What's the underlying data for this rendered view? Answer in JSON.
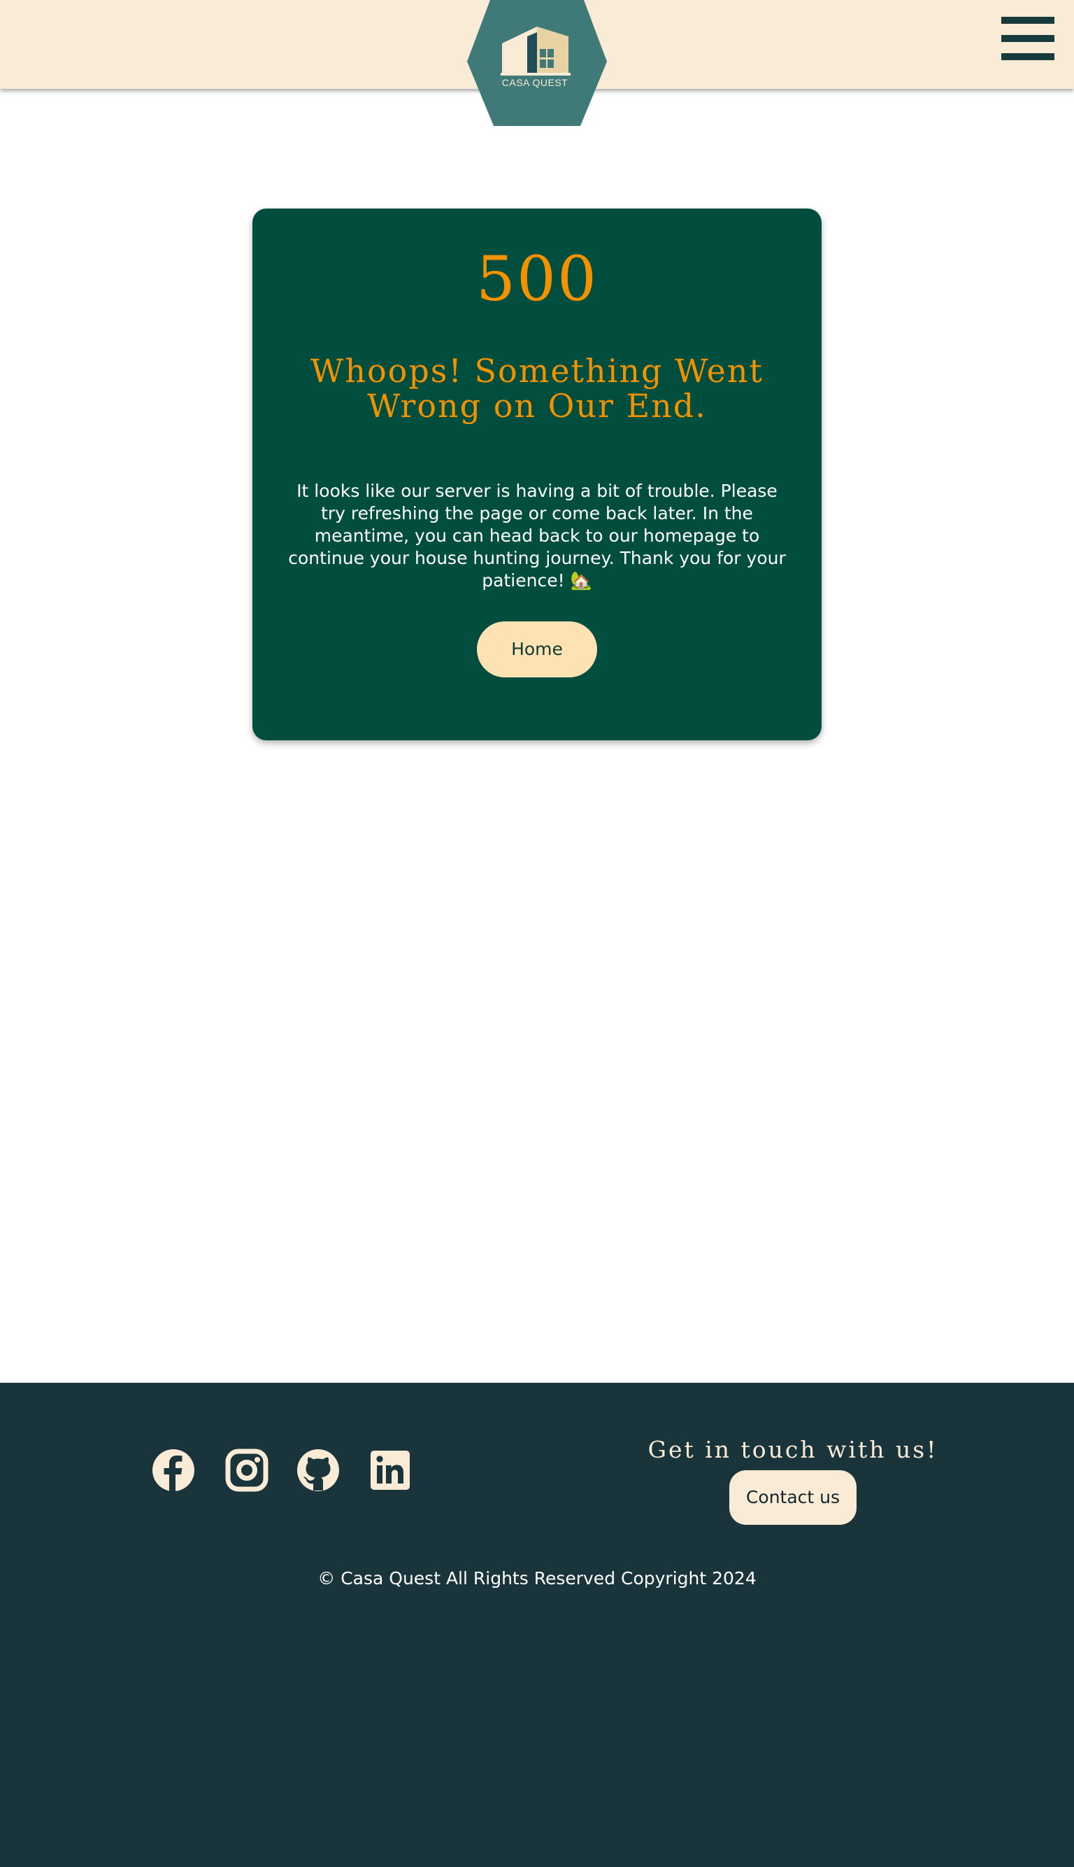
{
  "header": {
    "logo_text": "CASA QUEST",
    "menu_icon": "hamburger-menu-icon"
  },
  "error": {
    "code": "500",
    "title": "Whoops! Something Went Wrong on Our End.",
    "message": "It looks like our server is having a bit of trouble. Please try refreshing the page or come back later. In the meantime, you can head back to our homepage to continue your house hunting journey. Thank you for your patience! 🏡",
    "home_button": "Home"
  },
  "footer": {
    "social_icons": [
      "facebook-icon",
      "instagram-icon",
      "github-icon",
      "linkedin-icon"
    ],
    "touch_heading": "Get in touch with us!",
    "contact_button": "Contact us",
    "copyright": "© Casa Quest All Rights Reserved Copyright 2024"
  },
  "colors": {
    "header_bg": "#faebd7",
    "card_bg": "#024e3e",
    "accent": "#f29200",
    "button_bg": "#fde2b4",
    "footer_bg": "#19343a",
    "logo_bg": "#3f7a78"
  }
}
